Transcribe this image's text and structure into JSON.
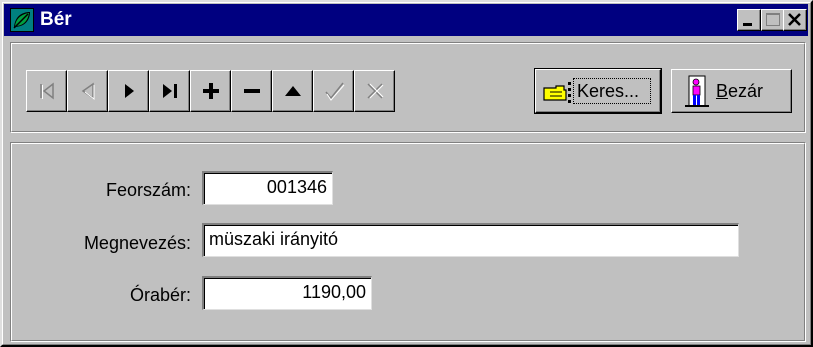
{
  "window": {
    "title": "Bér"
  },
  "toolbar": {
    "nav_buttons": [
      "first-icon",
      "prior-icon",
      "next-icon",
      "last-icon",
      "insert-icon",
      "delete-icon",
      "edit-icon",
      "post-icon",
      "cancel-icon"
    ],
    "keres_label": "Keres...",
    "bezar_label": "Bezár",
    "bezar_hotkey": "B"
  },
  "form": {
    "feorszam_label": "Feorszám:",
    "feorszam_value": "001346",
    "megnevezes_label": "Megnevezés:",
    "megnevezes_value": "müszaki irányitó",
    "oraber_label": "Órabér:",
    "oraber_value": "1190,00"
  },
  "colors": {
    "titlebar": "#000080",
    "face": "#c0c0c0",
    "disabled_glyph": "#808080"
  }
}
